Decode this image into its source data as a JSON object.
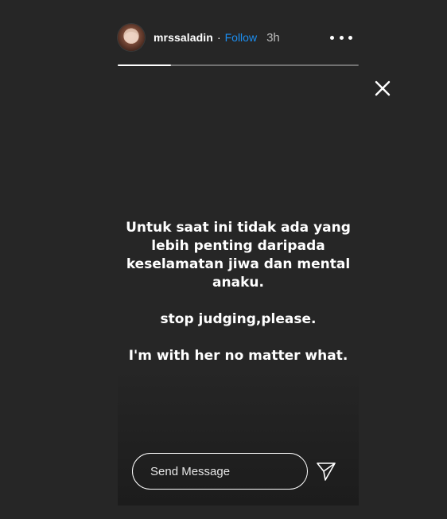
{
  "header": {
    "username": "mrssaladin",
    "separator": "·",
    "follow_label": "Follow",
    "time": "3h"
  },
  "progress": {
    "segments": 1,
    "current_fraction": 0.22
  },
  "story": {
    "paragraphs": [
      [
        "Untuk saat ini tidak ada yang",
        "lebih penting daripada",
        "keselamatan jiwa dan mental",
        "anaku."
      ],
      [
        "stop judging,please."
      ],
      [
        "I'm with her no matter what."
      ]
    ]
  },
  "reply": {
    "placeholder": "Send Message"
  },
  "icons": {
    "more": "more-horizontal-icon",
    "close": "close-icon",
    "send": "send-paper-plane-icon"
  },
  "colors": {
    "background": "#262626",
    "follow": "#1c8ef0",
    "text": "#ffffff",
    "time": "#bdbdbd"
  }
}
